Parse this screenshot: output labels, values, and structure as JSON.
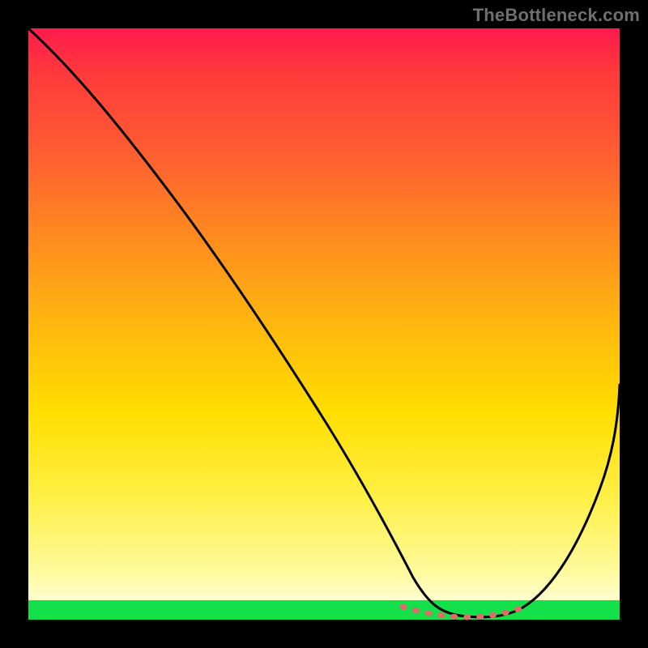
{
  "watermark": "TheBottleneck.com",
  "chart_data": {
    "type": "line",
    "title": "",
    "xlabel": "",
    "ylabel": "",
    "xlim": [
      0,
      100
    ],
    "ylim": [
      0,
      100
    ],
    "grid": false,
    "legend": false,
    "annotations": [],
    "background_gradient": {
      "orientation": "vertical",
      "stops": [
        {
          "pos": 0,
          "color": "#ff1a4d"
        },
        {
          "pos": 0.35,
          "color": "#ff8a1f"
        },
        {
          "pos": 0.65,
          "color": "#ffde00"
        },
        {
          "pos": 0.93,
          "color": "#fffa9e"
        },
        {
          "pos": 0.967,
          "color": "#13e04a"
        },
        {
          "pos": 1.0,
          "color": "#13e04a"
        }
      ]
    },
    "series": [
      {
        "name": "bottleneck-curve",
        "color": "#000000",
        "x": [
          0,
          5,
          10,
          15,
          20,
          25,
          30,
          35,
          40,
          45,
          50,
          55,
          60,
          63,
          66,
          70,
          74,
          78,
          81,
          84,
          88,
          92,
          96,
          100
        ],
        "y": [
          100,
          95,
          89,
          82,
          75,
          67,
          60,
          52,
          44,
          36,
          28,
          20,
          12,
          7,
          4,
          1,
          0,
          0,
          1,
          3,
          9,
          18,
          29,
          42
        ]
      },
      {
        "name": "minimum-marker",
        "color": "#e26a6a",
        "style": "dotted",
        "x": [
          63,
          66,
          70,
          74,
          78,
          81,
          84
        ],
        "y": [
          1,
          0.6,
          0.2,
          0.1,
          0.2,
          0.6,
          1.1
        ]
      }
    ]
  }
}
